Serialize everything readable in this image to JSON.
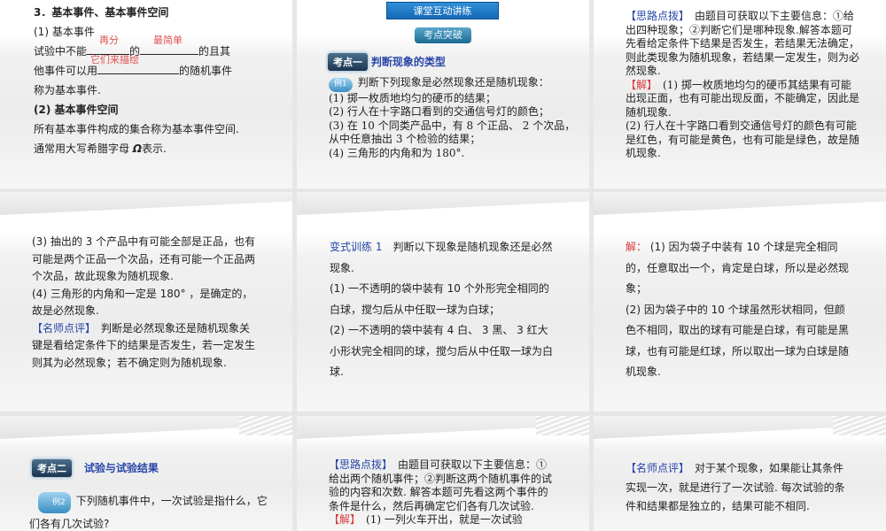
{
  "slides": [
    {
      "heading": "3．基本事件、基本事件空间",
      "sub1": "(1) 基本事件",
      "l1a": "试验中不能",
      "l1b": "的",
      "l1c": "的且其",
      "l2a": "他事件可以用",
      "l2b": "的随机事件",
      "l3": "称为基本事件.",
      "fill1": "再分",
      "fill2": "最简单",
      "fill3": "它们来描绘",
      "sub2": "(2) 基本事件空间",
      "l4": "所有基本事件构成的集合称为基本事件空间.",
      "l5a": "通常用大写希腊字母",
      "omega": "Ω",
      "l5b": "表示."
    },
    {
      "banner": "课堂互动讲练",
      "pill": "考点突破",
      "kd": "考点一",
      "kd_title": "判断现象的类型",
      "ex": "例1",
      "q": "判断下列现象是必然现象还是随机现象：",
      "items": [
        "(1) 掷一枚质地均匀的硬币的结果；",
        "(2) 行人在十字路口看到的交通信号灯的颜色；",
        "(3) 在 10 个同类产品中，有 8 个正品、 2 个次品，从中任意抽出 3 个检验的结果；",
        "(4) 三角形的内角和为 180°."
      ]
    },
    {
      "tag1": "【思路点拨】",
      "t1": "　由题目可获取以下主要信息：①给出四种现象；②判断它们是哪种现象.解答本题可先看给定条件下结果是否发生，若结果无法确定，则此类现象为随机现象，若结果一定发生，则为必然现象.",
      "tag2": "【解】",
      "t2": "　(1) 掷一枚质地均匀的硬币其结果有可能出现正面，也有可能出现反面，不能确定，因此是随机现象.",
      "t3": "(2) 行人在十字路口看到交通信号灯的颜色有可能是红色，有可能是黄色，也有可能是绿色，故是随机现象."
    },
    {
      "l1": "(3) 抽出的 3 个产品中有可能全部是正品，也有可能是两个正品一个次品，还有可能一个正品两个次品，故此现象为随机现象.",
      "l2": "(4) 三角形的内角和一定是 180° ，是确定的，故是必然现象.",
      "tag": "【名师点评】",
      "l3": "　判断是必然现象还是随机现象关键是看给定条件下的结果是否发生，若一定发生则其为必然现象；若不确定则为随机现象."
    },
    {
      "tag": "变式训练 1",
      "q": "　判断以下现象是随机现象还是必然现象.",
      "i1": "(1) 一不透明的袋中装有 10 个外形完全相同的白球，搅匀后从中任取一球为白球；",
      "i2": "(2) 一不透明的袋中装有 4 白、 3 黑、 3 红大小形状完全相同的球，搅匀后从中任取一球为白球."
    },
    {
      "tag": "解：",
      "a1": " (1) 因为袋子中装有 10 个球是完全相同的，任意取出一个，肯定是白球，所以是必然现象；",
      "a2": "(2) 因为袋子中的 10 个球虽然形状相同，但颜色不相同，取出的球有可能是白球，有可能是黑球，也有可能是红球，所以取出一球为白球是随机现象."
    },
    {
      "kd": "考点二",
      "kd_title": "试验与试验结果",
      "ex": "例2",
      "q": "下列随机事件中，一次试验是指什么，它们各有几次试验?"
    },
    {
      "tag1": "【思路点拨】",
      "t1": "　由题目可获取以下主要信息：① 给出两个随机事件；②判断这两个随机事件的试验的内容和次数. 解答本题可先看这两个事件的条件是什么，然后再确定它们各有几次试验.",
      "tag2": "【解】",
      "t2": "　(1) 一列火车开出，就是一次试验"
    },
    {
      "tag": "【名师点评】",
      "t": "　对于某个现象，如果能让其条件实现一次，就是进行了一次试验. 每次试验的条件和结果都是独立的，结果可能不相同."
    }
  ]
}
